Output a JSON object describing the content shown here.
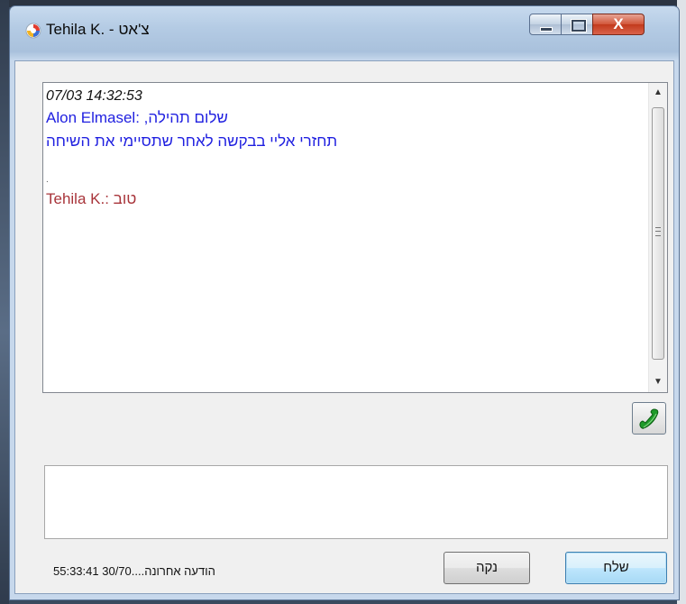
{
  "window": {
    "title_name": "Tehila K.",
    "title_separator": " - ",
    "title_app": "צ'אט",
    "close_glyph": "X",
    "app_icon": "chat-app-icon"
  },
  "chat": {
    "timestamp": "07/03 14:32:53",
    "messages": [
      {
        "sender": "Alon Elmasel:",
        "lines": [
          "שלום תהילה,",
          "תחזרי אליי בבקשה לאחר שתסיימי את השיחה"
        ],
        "color": "#1f1fe0"
      },
      {
        "sender": "Tehila K.:",
        "lines": [
          "טוב"
        ],
        "color": "#a8343a"
      }
    ],
    "separator_dot": "."
  },
  "call_button": {
    "icon": "phone-icon",
    "color": "#1f9a2a"
  },
  "input": {
    "value": ""
  },
  "status": {
    "label": "הודעה אחרונה....",
    "date": "07/03",
    "time": "14:33:55"
  },
  "buttons": {
    "clear_label": "נקה",
    "send_label": "שלח"
  }
}
